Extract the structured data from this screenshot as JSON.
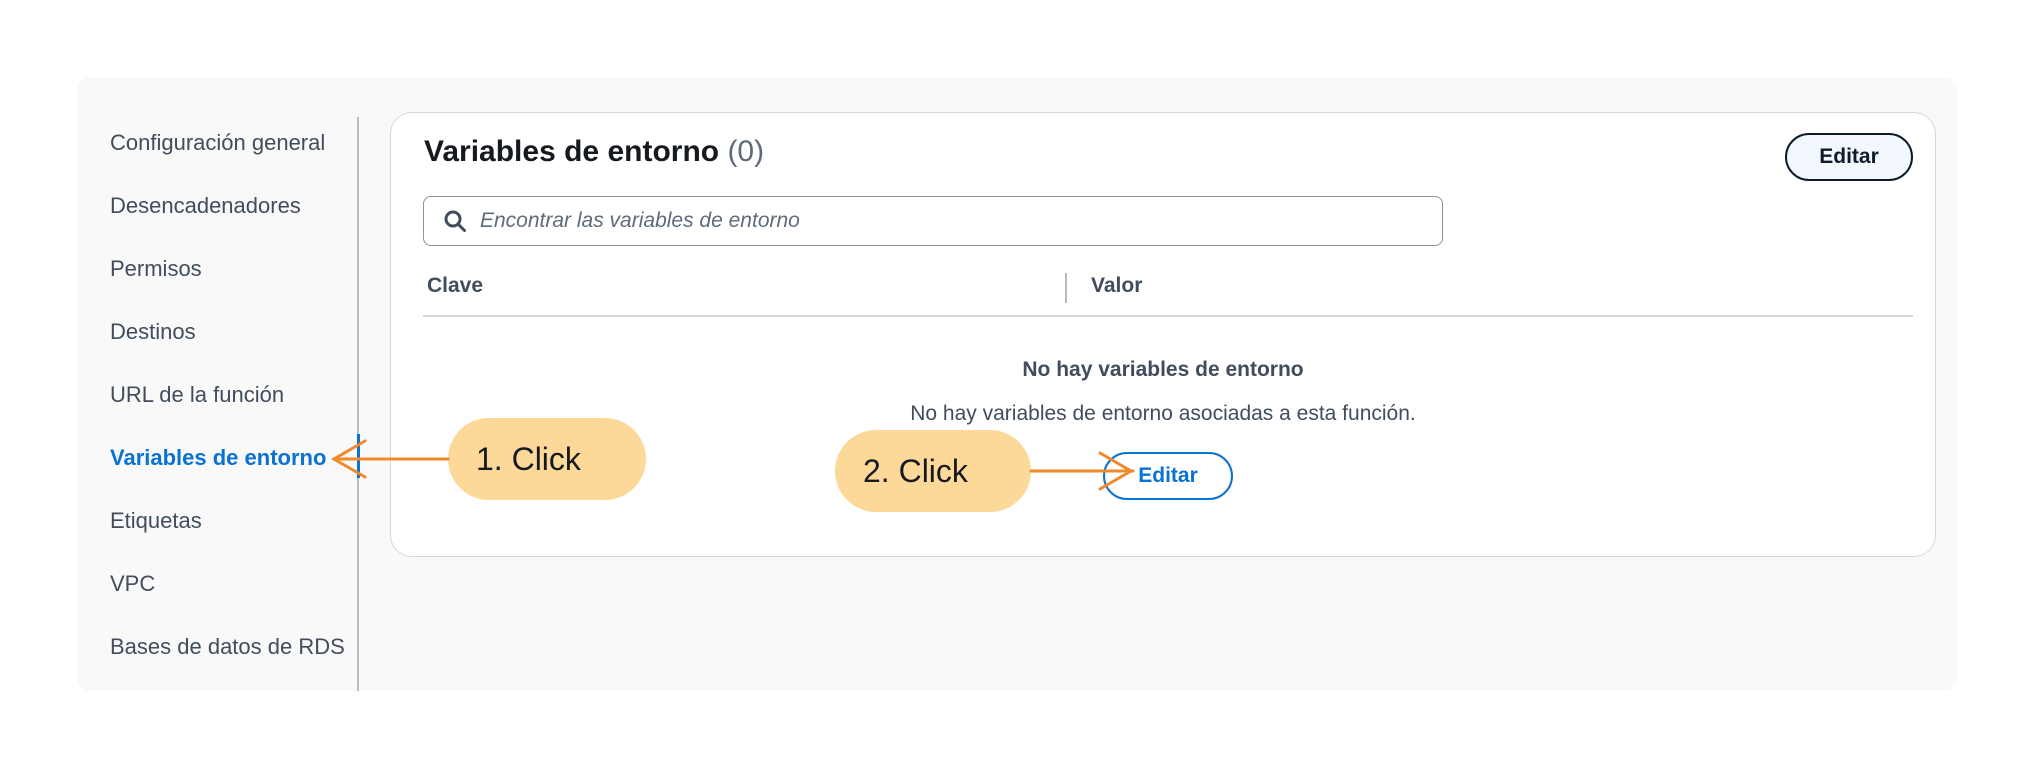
{
  "sidebar": {
    "items": [
      {
        "label": "Configuración general"
      },
      {
        "label": "Desencadenadores"
      },
      {
        "label": "Permisos"
      },
      {
        "label": "Destinos"
      },
      {
        "label": "URL de la función"
      },
      {
        "label": "Variables de entorno",
        "active": true
      },
      {
        "label": "Etiquetas"
      },
      {
        "label": "VPC"
      },
      {
        "label": "Bases de datos de RDS"
      }
    ]
  },
  "panel": {
    "title": "Variables de entorno",
    "count": "(0)",
    "edit_label": "Editar",
    "search": {
      "placeholder": "Encontrar las variables de entorno",
      "value": ""
    },
    "table": {
      "columns": [
        "Clave",
        "Valor"
      ]
    },
    "empty": {
      "title": "No hay variables de entorno",
      "description": "No hay variables de entorno asociadas a esta función.",
      "button_label": "Editar"
    }
  },
  "annotations": {
    "step1": "1. Click",
    "step2": "2. Click"
  },
  "colors": {
    "accent": "#0972d3",
    "callout": "#fdd999",
    "arrow": "#f0892b"
  },
  "icons": {
    "search": "search-icon"
  }
}
